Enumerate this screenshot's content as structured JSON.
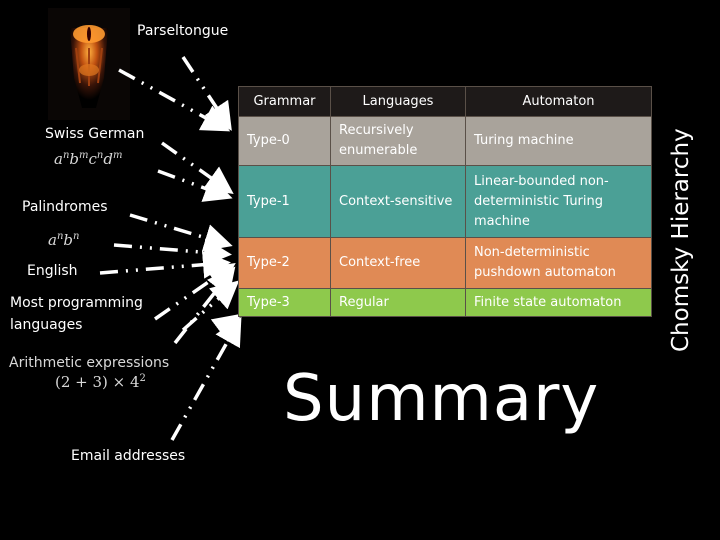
{
  "slide": {
    "title": "Summary",
    "side_title": "Chomsky Hierarchy",
    "image_alt": "Eye of Sauron image",
    "labels": {
      "parseltongue": "Parseltongue",
      "swiss_german": "Swiss German",
      "swiss_german_expr": [
        "a",
        "n",
        "b",
        "m",
        "c",
        "n",
        "d",
        "m"
      ],
      "palindromes": "Palindromes",
      "palindromes_expr": [
        "a",
        "n",
        "b",
        "n"
      ],
      "english": "English",
      "programming_line1": "Most programming",
      "programming_line2": "languages",
      "arithmetic": "Arithmetic expressions",
      "arithmetic_expr": "(2 + 3) × 4",
      "arithmetic_exp": "2",
      "email": "Email addresses"
    }
  },
  "table": {
    "headers": [
      "Grammar",
      "Languages",
      "Automaton"
    ],
    "rows": [
      {
        "grammar": "Type-0",
        "languages": "Recursively enumerable",
        "automaton": "Turing machine",
        "color": "#a9a39b"
      },
      {
        "grammar": "Type-1",
        "languages": "Context-sensitive",
        "automaton": "Linear-bounded non-deterministic Turing machine",
        "color": "#4ba096"
      },
      {
        "grammar": "Type-2",
        "languages": "Context-free",
        "automaton": "Non-deterministic pushdown automaton",
        "color": "#e08a55"
      },
      {
        "grammar": "Type-3",
        "languages": "Regular",
        "automaton": "Finite state automaton",
        "color": "#8ec94c"
      }
    ],
    "header_color": "#1e1a19"
  }
}
